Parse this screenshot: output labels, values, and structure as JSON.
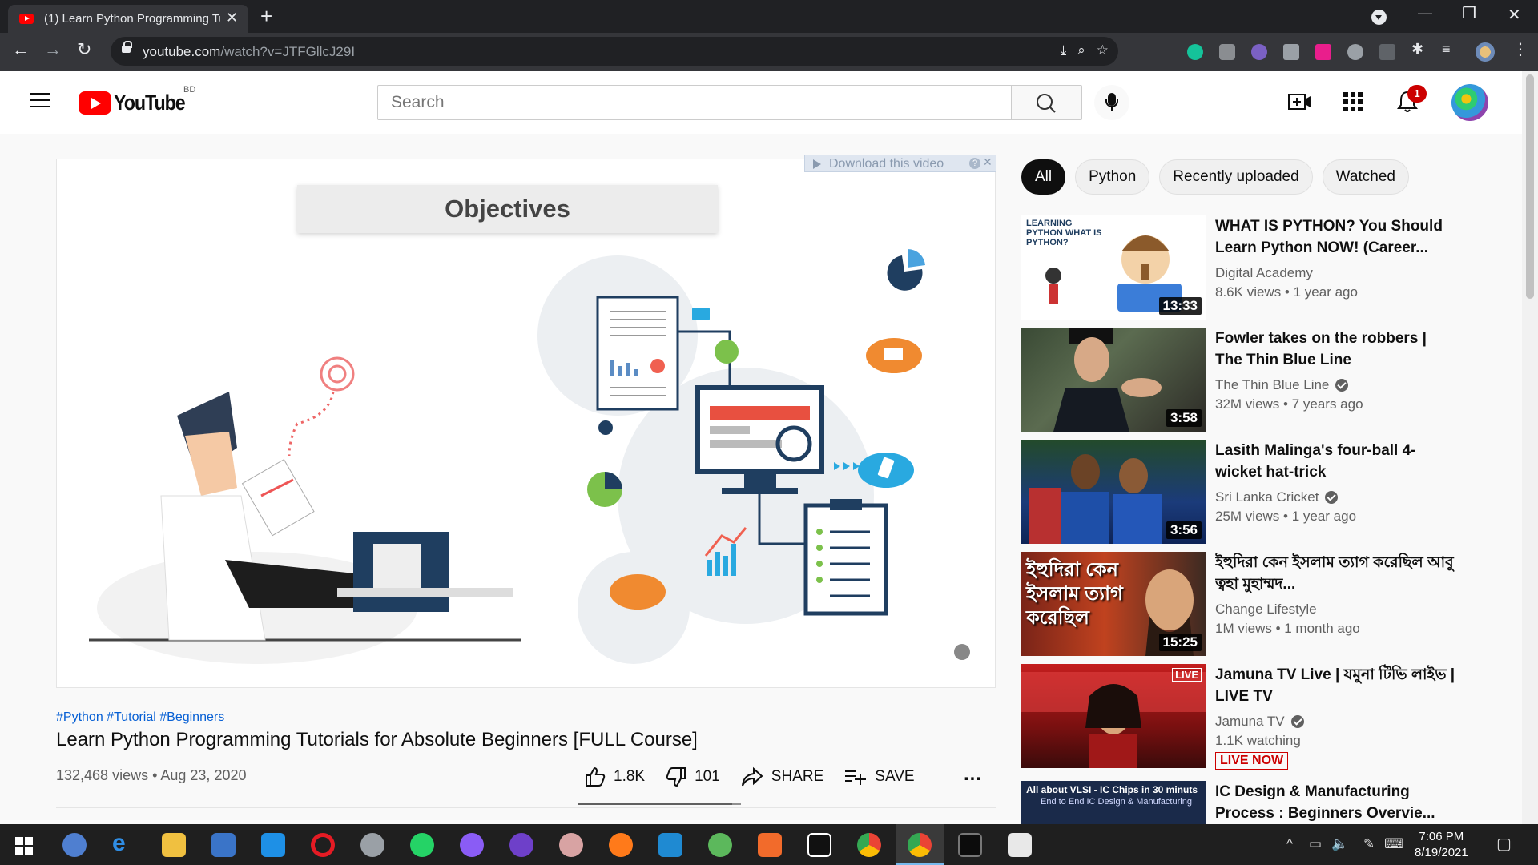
{
  "browser": {
    "tab_title": "(1) Learn Python Programming Tu",
    "url_host": "youtube.com",
    "url_path": "/watch?v=JTFGllcJ29I"
  },
  "masthead": {
    "logo_text": "YouTube",
    "country": "BD",
    "search_placeholder": "Search",
    "notification_count": "1"
  },
  "video": {
    "download_label": "Download this video",
    "download_help": "?",
    "slide_heading": "Objectives",
    "hashtags": "#Python #Tutorial #Beginners",
    "title": "Learn Python Programming Tutorials for Absolute Beginners [FULL Course]",
    "meta": "132,468 views • Aug 23, 2020",
    "likes": "1.8K",
    "dislikes": "101",
    "like_ratio": 0.947,
    "share_label": "SHARE",
    "save_label": "SAVE",
    "more_label": "..."
  },
  "chips": [
    "All",
    "Python",
    "Recently uploaded",
    "Watched"
  ],
  "recommendations": [
    {
      "title": "WHAT IS PYTHON? You Should Learn Python NOW! (Career...",
      "channel": "Digital Academy",
      "verified": false,
      "stats": "8.6K views • 1 year ago",
      "duration": "13:33",
      "thumb_text": "LEARNING PYTHON WHAT IS PYTHON?"
    },
    {
      "title": "Fowler takes on the robbers | The Thin Blue Line",
      "channel": "The Thin Blue Line",
      "verified": true,
      "stats": "32M views • 7 years ago",
      "duration": "3:58"
    },
    {
      "title": "Lasith Malinga's four-ball 4-wicket hat-trick",
      "channel": "Sri Lanka Cricket",
      "verified": true,
      "stats": "25M views • 1 year ago",
      "duration": "3:56"
    },
    {
      "title": "ইহুদিরা কেন ইসলাম ত্যাগ করেছিল আবু ত্বহা মুহাম্মদ...",
      "channel": "Change Lifestyle",
      "verified": false,
      "stats": "1M views • 1 month ago",
      "duration": "15:25",
      "thumb_text": "ইহুদিরা কেন ইসলাম ত্যাগ করেছিল"
    },
    {
      "title": "Jamuna TV Live | যমুনা টিভি লাইভ | LIVE TV",
      "channel": "Jamuna TV",
      "verified": true,
      "stats": "1.1K watching",
      "badge": "LIVE NOW",
      "thumb_text": "LIVE"
    },
    {
      "title": "IC Design & Manufacturing Process : Beginners Overvie...",
      "thumb_text": "All about VLSI - IC Chips in 30 minuts",
      "thumb_subtext": "End to End IC Design & Manufacturing"
    }
  ],
  "taskbar": {
    "time": "7:06 PM",
    "date": "8/19/2021"
  }
}
